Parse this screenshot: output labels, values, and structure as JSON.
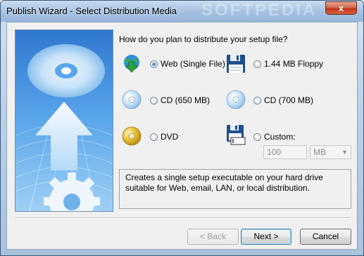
{
  "window": {
    "title": "Publish Wizard - Select Distribution Media",
    "watermark": "SOFTPEDIA",
    "close_glyph": "x"
  },
  "main": {
    "question": "How do you plan to distribute your setup file?",
    "options": [
      {
        "label": "Web (Single File)",
        "icon": "globe-download-icon",
        "checked": true
      },
      {
        "label": "1.44 MB Floppy",
        "icon": "floppy-disk-icon",
        "checked": false
      },
      {
        "label": "CD (650 MB)",
        "icon": "cd-icon",
        "checked": false
      },
      {
        "label": "CD (700 MB)",
        "icon": "cd-icon",
        "checked": false
      },
      {
        "label": "DVD",
        "icon": "dvd-icon",
        "checked": false
      },
      {
        "label": "Custom:",
        "icon": "custom-floppy-icon",
        "checked": false
      }
    ],
    "custom_size": {
      "value": "100",
      "unit": "MB"
    },
    "description": "Creates a single setup executable on your hard drive suitable for Web, email, LAN, or local distribution."
  },
  "buttons": {
    "back": "< Back",
    "next": "Next >",
    "cancel": "Cancel"
  },
  "colors": {
    "accent": "#1a4fa8",
    "banner_blue": "#4a8fd8"
  }
}
